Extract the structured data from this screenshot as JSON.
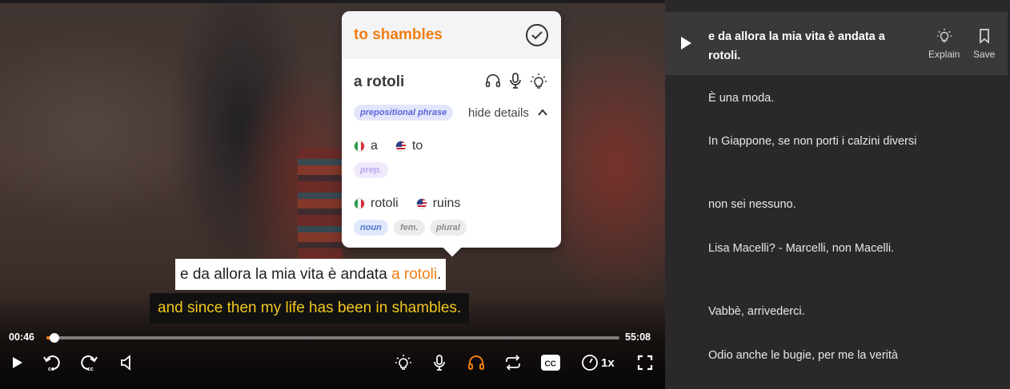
{
  "popup": {
    "title": "to shambles",
    "word": "a rotoli",
    "phrase_type": "prepositional phrase",
    "toggle_label": "hide details",
    "breakdown": [
      {
        "source": "a",
        "target": "to",
        "tags": [
          "prep."
        ]
      },
      {
        "source": "rotoli",
        "target": "ruins",
        "tags": [
          "noun",
          "fem.",
          "plural"
        ]
      }
    ]
  },
  "subtitles": {
    "italian_before": "e da allora la mia vita è andata ",
    "italian_highlight": "a rotoli",
    "italian_after": ".",
    "english": "and since then my life has been in shambles."
  },
  "player": {
    "current_time": "00:46",
    "duration": "55:08",
    "progress_fraction": 0.014,
    "speed": "1x",
    "icons": [
      "play-icon",
      "rewind-cc-icon",
      "forward-cc-icon",
      "volume-icon",
      "lightbulb-icon",
      "microphone-icon",
      "headphones-icon",
      "repeat-icon",
      "cc-icon",
      "speed-icon",
      "fullscreen-icon"
    ],
    "cc_label": "CC"
  },
  "transcript": {
    "active_line": "e da allora la mia vita è andata a rotoli.",
    "explain_label": "Explain",
    "save_label": "Save",
    "lines": [
      "È una moda.",
      "In Giappone, se non porti i calzini diversi",
      "non sei nessuno.",
      "Lisa Macelli? - Marcelli, non Macelli.",
      "Vabbè, arrivederci.",
      "Odio anche le bugie, per me la verità"
    ]
  },
  "colors": {
    "accent": "#f07d12",
    "subtitle_english": "#f2c71c",
    "panel_bg": "#2b282c",
    "active_row_bg": "#3b383c"
  }
}
